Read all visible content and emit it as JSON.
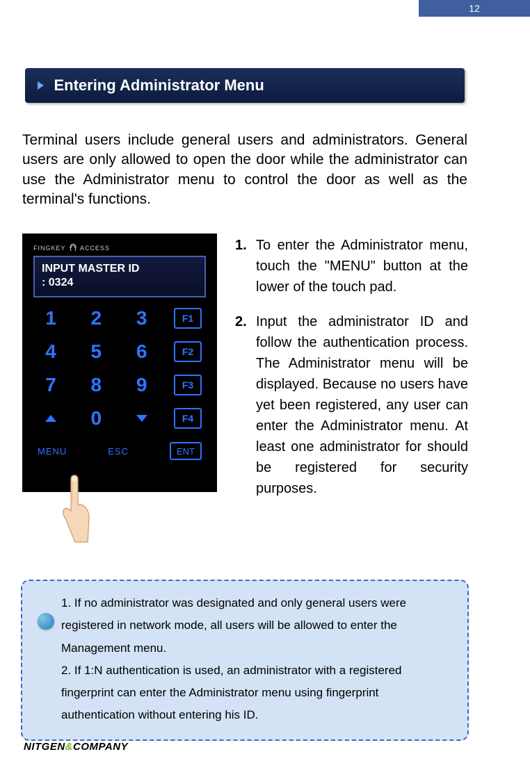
{
  "page_number": "12",
  "title": "Entering Administrator Menu",
  "intro": "Terminal users include general users and administrators. General users are only allowed to open the door while the administrator can use the Administrator menu to control the door as well as the terminal's functions.",
  "device": {
    "brand_left": "FINGKEY",
    "brand_right": "ACCESS",
    "screen_line1": "INPUT MASTER ID",
    "screen_line2": ": 0324",
    "keys": {
      "r1": [
        "1",
        "2",
        "3"
      ],
      "f1": "F1",
      "r2": [
        "4",
        "5",
        "6"
      ],
      "f2": "F2",
      "r3": [
        "7",
        "8",
        "9"
      ],
      "f3": "F3",
      "r4_mid": "0",
      "f4": "F4",
      "menu": "MENU",
      "esc": "ESC",
      "ent": "ENT"
    }
  },
  "steps": [
    {
      "num": "1.",
      "text": "To enter the Administrator menu, touch the \"MENU\" button at the lower of the touch pad."
    },
    {
      "num": "2.",
      "text": "Input the administrator ID and follow the authentication process. The Administrator menu will be displayed. Because no users have yet been registered, any user can enter the Administrator menu. At least one administrator for should be registered for security purposes."
    }
  ],
  "tip": {
    "line1": "1. If no administrator was designated and only general users were registered in network mode, all users will be allowed to enter the Management menu.",
    "line2": "2. If 1:N authentication is used, an administrator with a registered fingerprint can enter the Administrator menu using fingerprint authentication without entering his ID."
  },
  "footer": {
    "a": "NITGEN",
    "amp": "&",
    "b": "COMPANY"
  }
}
